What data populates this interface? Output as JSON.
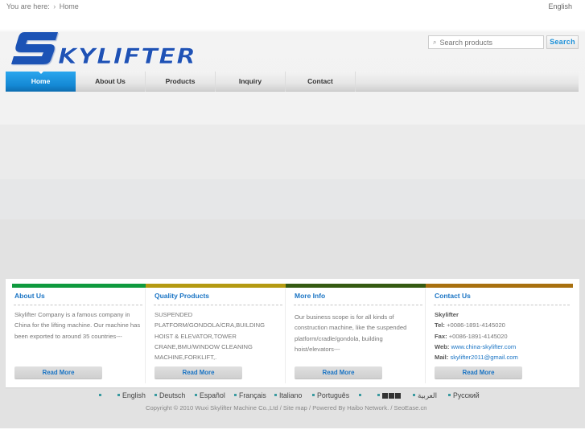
{
  "breadcrumb": {
    "prefix": "You are here:",
    "separator": "›",
    "current": "Home"
  },
  "language_selector": "English",
  "logo": {
    "text": "SKYLIFTER",
    "color": "#1f52b5"
  },
  "search": {
    "placeholder": "Search products",
    "value": "",
    "button_label": "Search",
    "icon": "search-icon"
  },
  "nav": {
    "items": [
      {
        "label": "Home",
        "active": true
      },
      {
        "label": "About Us",
        "active": false
      },
      {
        "label": "Products",
        "active": false
      },
      {
        "label": "Inquiry",
        "active": false
      },
      {
        "label": "Contact",
        "active": false
      }
    ],
    "accent": "#1a8fd8"
  },
  "columns": [
    {
      "title": "About Us",
      "bar_color": "#0f9a3e",
      "text": "Skylifter Company is a famous company in China for the lifting machine. Our machine has been exported to around 35 countries---",
      "button": "Read More"
    },
    {
      "title": "Quality Products",
      "bar_color": "#b49a12",
      "text": "SUSPENDED PLATFORM/GONDOLA/CRA,BUILDING HOIST & ELEVATOR,TOWER CRANE,BMU/WINDOW CLEANING MACHINE,FORKLIFT,.",
      "button": "Read More"
    },
    {
      "title": "More Info",
      "bar_color": "#355a12",
      "text": "Our business scope is for all kinds of construction machine, like the suspended platform/cradle/gondola, building hoist/elevators---",
      "button": "Read More"
    },
    {
      "title": "Contact Us",
      "bar_color": "#a8700f",
      "company": "Skylifter",
      "tel_label": "Tel:",
      "tel": "+0086-1891-4145020",
      "fax_label": "Fax:",
      "fax": "+0086-1891-4145020",
      "web_label": "Web:",
      "web": "www.china-skylifter.com",
      "mail_label": "Mail:",
      "mail": "skylifter2011@gmail.com",
      "button": "Read More"
    }
  ],
  "footer": {
    "languages": [
      "",
      "English",
      "Deutsch",
      "Español",
      "Français",
      "Italiano",
      "Português",
      "",
      "■■■",
      "العربية",
      "Русский"
    ],
    "copyright": "Copyright © 2010 Wuxi Skylifter Machine Co.,Ltd",
    "links": [
      "Site map",
      "Powered By Haibo Network.",
      "SeoEase.cn"
    ],
    "separator": " / "
  }
}
